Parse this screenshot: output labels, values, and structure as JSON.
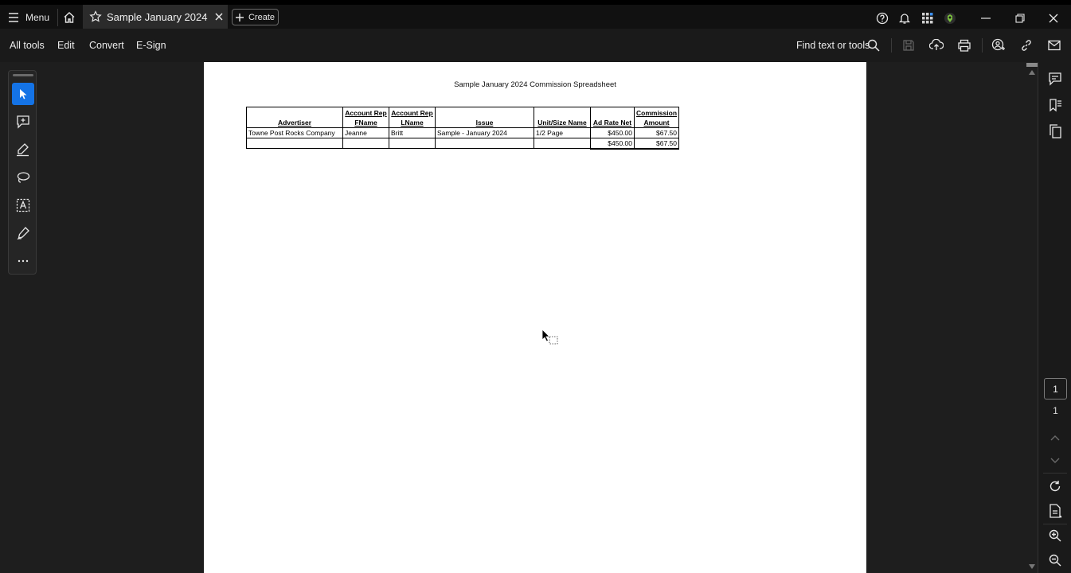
{
  "titlebar": {
    "menu_label": "Menu",
    "tab_title": "Sample January 2024 Co...",
    "create_label": "Create"
  },
  "toolbar": {
    "all_tools": "All tools",
    "edit": "Edit",
    "convert": "Convert",
    "esign": "E-Sign",
    "find": "Find text or tools"
  },
  "document": {
    "title": "Sample January 2024 Commission Spreadsheet",
    "columns": [
      {
        "line1": "",
        "line2": "Advertiser"
      },
      {
        "line1": "Account Rep",
        "line2": "FName"
      },
      {
        "line1": "Account Rep",
        "line2": "LName"
      },
      {
        "line1": "",
        "line2": "Issue"
      },
      {
        "line1": "",
        "line2": "Unit/Size Name"
      },
      {
        "line1": "",
        "line2": "Ad Rate Net"
      },
      {
        "line1": "Commission",
        "line2": "Amount"
      }
    ],
    "rows": [
      [
        "Towne Post Rocks Company",
        "Jeanne",
        "Britt",
        "Sample - January 2024",
        "1/2 Page",
        "$450.00",
        "$67.50"
      ]
    ],
    "totals": {
      "ad_rate_net": "$450.00",
      "commission": "$67.50"
    }
  },
  "pager": {
    "current_page": "1",
    "total_pages": "1"
  },
  "colors": {
    "accent": "#1473e6",
    "titlebar": "#111111",
    "toolbar": "#1a1a1a",
    "canvas": "#1e1e1e",
    "page": "#ffffff"
  },
  "icons": {
    "titlebar": [
      "menu-icon",
      "home-icon",
      "star-icon",
      "close-icon",
      "plus-icon",
      "help-icon",
      "bell-icon",
      "apps-icon",
      "profile-icon",
      "minimize-icon",
      "restore-icon",
      "window-close-icon"
    ],
    "toolbar": [
      "search-icon",
      "save-icon",
      "upload-icon",
      "print-icon",
      "share-icon",
      "link-icon",
      "mail-icon"
    ],
    "left_rail": [
      "select-arrow-icon",
      "add-comment-icon",
      "highlight-icon",
      "lasso-icon",
      "text-select-icon",
      "sign-icon",
      "more-icon"
    ],
    "right_rail": [
      "comments-icon",
      "bookmarks-icon",
      "pages-icon",
      "chevron-up-icon",
      "chevron-down-icon",
      "refresh-icon",
      "page-settings-icon",
      "zoom-in-icon",
      "zoom-out-icon"
    ]
  }
}
